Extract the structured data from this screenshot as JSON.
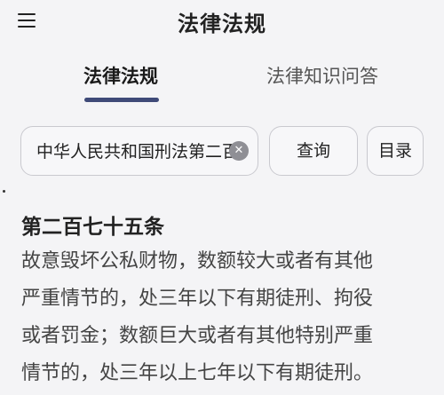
{
  "header": {
    "title": "法律法规",
    "menu_icon": "hamburger-menu-icon"
  },
  "tabs": [
    {
      "label": "法律法规",
      "active": true
    },
    {
      "label": "法律知识问答",
      "active": false
    }
  ],
  "search": {
    "value": "中华人民共和国刑法第二百七十五条",
    "clear_icon": "clear-icon"
  },
  "buttons": {
    "query": "查询",
    "toc": "目录"
  },
  "article": {
    "title": "第二百七十五条",
    "lines": [
      "故意毁坏公私财物，数额较大或者有其他",
      "严重情节的，处三年以下有期徒刑、拘役",
      "或者罚金；数额巨大或者有其他特别严重",
      "情节的，处三年以上七年以下有期徒刑。"
    ]
  },
  "colors": {
    "accent": "#3f4a78",
    "background": "#f4f4f6"
  }
}
